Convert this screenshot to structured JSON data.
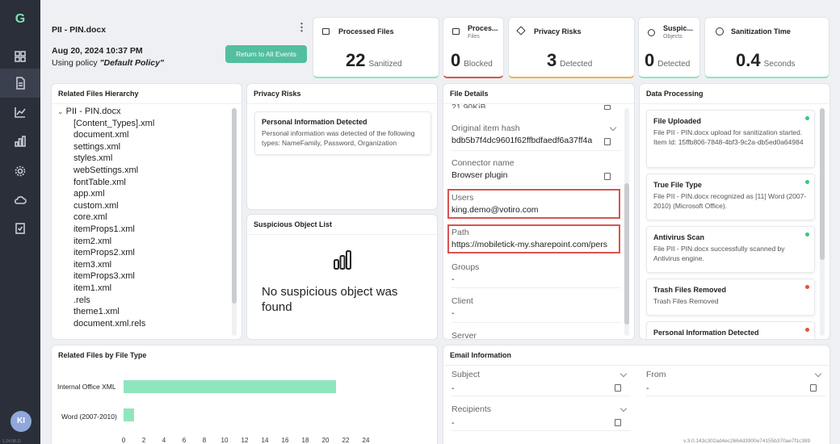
{
  "header": {
    "file_name": "PII - PIN.docx",
    "date": "Aug 20, 2024 10:37 PM",
    "policy_prefix": "Using policy ",
    "policy_name": "\"Default Policy\"",
    "return_label": "Return to All Events",
    "kebab": "⋮"
  },
  "stats": {
    "processed": {
      "label": "Processed Files",
      "value": "22",
      "unit": "Sanitized"
    },
    "blocked": {
      "label": "Proces...",
      "sub": "Files",
      "value": "0",
      "unit": "Blocked"
    },
    "privacy": {
      "label": "Privacy Risks",
      "value": "3",
      "unit": "Detected"
    },
    "suspicious": {
      "label": "Suspic...",
      "sub": "Objects",
      "value": "0",
      "unit": "Detected"
    },
    "sanitization": {
      "label": "Sanitization Time",
      "value": "0.4",
      "unit": "Seconds"
    }
  },
  "hierarchy": {
    "title": "Related Files Hierarchy",
    "root": "PII - PIN.docx",
    "items": [
      "[Content_Types].xml",
      "document.xml",
      "settings.xml",
      "styles.xml",
      "webSettings.xml",
      "fontTable.xml",
      "app.xml",
      "custom.xml",
      "core.xml",
      "itemProps1.xml",
      "item2.xml",
      "itemProps2.xml",
      "item3.xml",
      "itemProps3.xml",
      "item1.xml",
      ".rels",
      "theme1.xml",
      "document.xml.rels"
    ]
  },
  "privacy_risks": {
    "title": "Privacy Risks",
    "item_title": "Personal Information Detected",
    "item_desc": "Personal information was detected of the following types: NameFamily, Password, Organization"
  },
  "suspicious": {
    "title": "Suspicious Object List",
    "empty": "No suspicious object was found"
  },
  "file_details": {
    "title": "File Details",
    "partial_top": "21.90KiB",
    "hash_label": "Original item hash",
    "hash_value": "bdb5b7f4dc9601f62ffbdfaedf6a37ff4a",
    "connector_label": "Connector name",
    "connector_value": "Browser plugin",
    "users_label": "Users",
    "users_value": "king.demo@votiro.com",
    "path_label": "Path",
    "path_value": "https://mobiletick-my.sharepoint.com/pers",
    "groups_label": "Groups",
    "groups_value": "-",
    "client_label": "Client",
    "client_value": "-",
    "server_label": "Server"
  },
  "data_processing": {
    "title": "Data Processing",
    "items": [
      {
        "title": "File Uploaded",
        "desc": "File PII - PIN.docx upload for sanitization started. Item Id: 15ffb806-7848-4bf3-9c2a-db5ed0a64984",
        "status_color": "#3cc47c"
      },
      {
        "title": "True File Type",
        "desc": "File PII - PIN.docx recognized as [11] Word (2007-2010) (Microsoft Office).",
        "status_color": "#3cc47c"
      },
      {
        "title": "Antivirus Scan",
        "desc": "File PII - PIN.docx successfully scanned by Antivirus engine.",
        "status_color": "#3cc47c"
      },
      {
        "title": "Trash Files Removed",
        "desc": "Trash Files Removed",
        "status_color": "#e0533d"
      },
      {
        "title": "Personal Information Detected",
        "desc": "",
        "status_color": "#e0533d"
      }
    ]
  },
  "file_type_chart": {
    "title": "Related Files by File Type"
  },
  "chart_data": {
    "type": "bar",
    "orientation": "horizontal",
    "categories": [
      "Internal Office XML",
      "Word (2007-2010)"
    ],
    "values": [
      21,
      1
    ],
    "xlim": [
      0,
      24
    ],
    "xticks": [
      "0",
      "2",
      "4",
      "6",
      "8",
      "10",
      "12",
      "14",
      "16",
      "18",
      "20",
      "22",
      "24"
    ],
    "bar_color": "#8ee6bf"
  },
  "email": {
    "title": "Email Information",
    "subject_label": "Subject",
    "subject_value": "-",
    "from_label": "From",
    "from_value": "-",
    "recipients_label": "Recipients",
    "recipients_value": "-"
  },
  "version_text": "v.3.0.143c302ad4ec2664d3900e74155b370ae7f1c389",
  "side_version": "1.24.08.11",
  "avatar_initials": "KI"
}
